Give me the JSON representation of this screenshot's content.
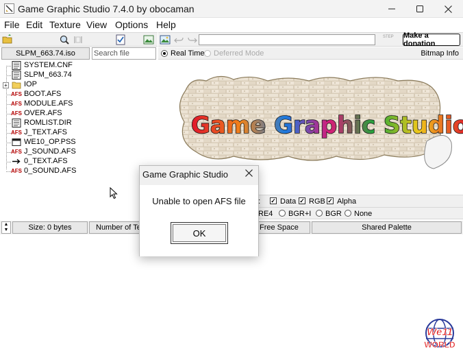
{
  "window": {
    "title": "Game Graphic Studio 7.4.0 by obocaman",
    "controls": [
      "minimize-icon",
      "maximize-icon",
      "close-icon"
    ]
  },
  "menu": [
    "File",
    "Edit",
    "Texture",
    "View",
    "Options",
    "Help"
  ],
  "toolbar": {
    "step_label": "STEP",
    "donate_label": "Make a donation"
  },
  "left_pane": {
    "iso_button": "SLPM_663.74.iso",
    "search_placeholder": "Search file",
    "tree": [
      {
        "label": "SYSTEM.CNF",
        "icon": "text-file-icon"
      },
      {
        "label": "SLPM_663.74",
        "icon": "text-file-icon"
      },
      {
        "label": "IOP",
        "icon": "folder-icon",
        "expandable": true
      },
      {
        "label": "BOOT.AFS",
        "icon": "afs-icon"
      },
      {
        "label": "MODULE.AFS",
        "icon": "afs-icon"
      },
      {
        "label": "OVER.AFS",
        "icon": "afs-icon"
      },
      {
        "label": "ROMLIST.DIR",
        "icon": "text-file-icon"
      },
      {
        "label": "J_TEXT.AFS",
        "icon": "afs-icon"
      },
      {
        "label": "WE10_OP.PSS",
        "icon": "video-icon"
      },
      {
        "label": "J_SOUND.AFS",
        "icon": "afs-icon"
      },
      {
        "label": "0_TEXT.AFS",
        "icon": "arrow-icon"
      },
      {
        "label": "0_SOUND.AFS",
        "icon": "afs-icon"
      }
    ]
  },
  "right_pane": {
    "mode_realtime": "Real Time",
    "mode_deferred": "Deferred Mode",
    "bitmap_info": "Bitmap Info",
    "logo_text": "Game Graphic Studio",
    "options_row1_prefix": "n:",
    "options_row1": [
      "Data",
      "RGB",
      "Alpha"
    ],
    "options_row2": [
      "RE4",
      "BGR+I",
      "BGR",
      "None"
    ]
  },
  "status": {
    "size": "Size: 0 bytes",
    "number_of_textures": "Number of Text",
    "free_space": "Free Space",
    "shared_palette": "Shared Palette"
  },
  "dialog": {
    "title": "Game Graphic Studio",
    "message": "Unable to open AFS file",
    "ok_label": "OK"
  },
  "watermark": {
    "line1": "We11",
    "line2": "WORLD"
  },
  "colors": {
    "afs_icon": "#b30000",
    "titlebar": "#f3f3f3",
    "panel": "#f0f0f0"
  }
}
